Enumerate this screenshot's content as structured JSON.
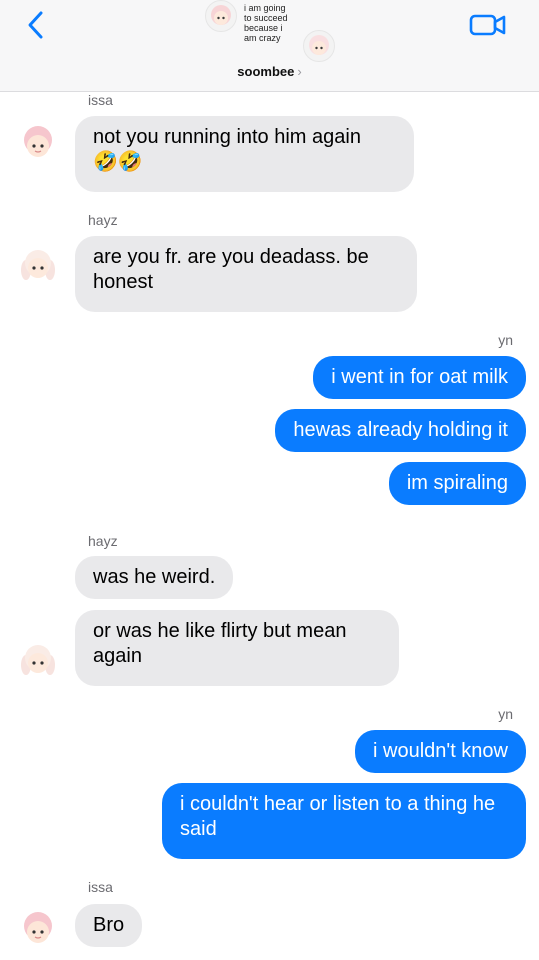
{
  "header": {
    "group_caption_lines": [
      "i am going",
      "to succeed",
      "because i",
      "am crazy"
    ],
    "title": "soombee",
    "chevron": "›",
    "back_icon": "back-chevron-icon",
    "video_icon": "video-camera-icon"
  },
  "colors": {
    "accent": "#0a7cff",
    "incoming_bubble": "#e9e9eb",
    "sender_label": "#6b6b70"
  },
  "messages": [
    {
      "sender": "issa",
      "side": "in",
      "text": "not you running into him again",
      "emoji": "🤣🤣"
    },
    {
      "sender": "hayz",
      "side": "in",
      "text": "are you fr. are you deadass. be honest"
    },
    {
      "sender": "yn",
      "side": "out",
      "text": "i went in for oat milk"
    },
    {
      "side": "out",
      "text": "hewas already holding it"
    },
    {
      "side": "out",
      "text": "im spiraling"
    },
    {
      "sender": "hayz",
      "side": "in",
      "text": "was he weird."
    },
    {
      "side": "in",
      "text": "or was he like flirty but mean again"
    },
    {
      "sender": "yn",
      "side": "out",
      "text": "i wouldn't know"
    },
    {
      "side": "out",
      "text": "i couldn't hear or listen to a thing he said"
    },
    {
      "sender": "issa",
      "side": "in",
      "text": "Bro"
    }
  ]
}
